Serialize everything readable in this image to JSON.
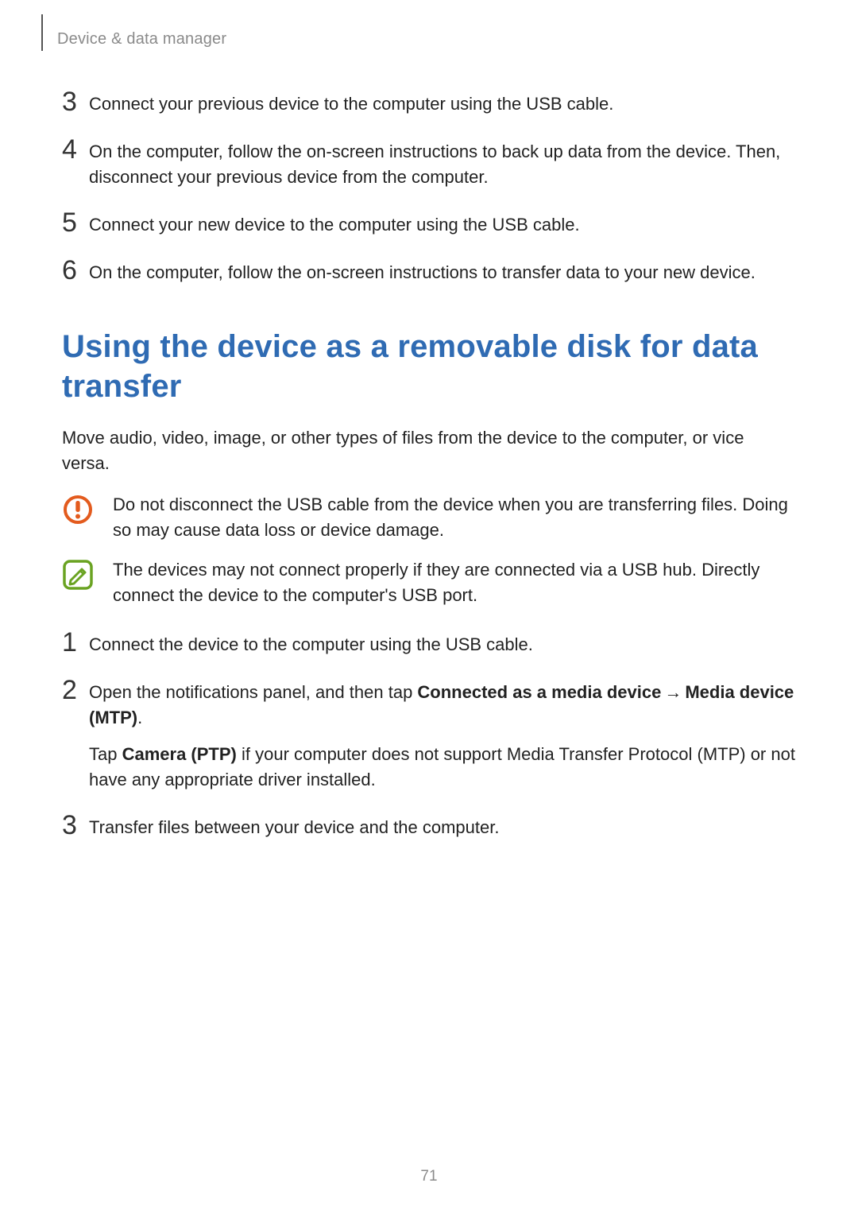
{
  "breadcrumb": "Device & data manager",
  "top_steps": [
    {
      "num": "3",
      "text": "Connect your previous device to the computer using the USB cable."
    },
    {
      "num": "4",
      "text": "On the computer, follow the on-screen instructions to back up data from the device. Then, disconnect your previous device from the computer."
    },
    {
      "num": "5",
      "text": "Connect your new device to the computer using the USB cable."
    },
    {
      "num": "6",
      "text": "On the computer, follow the on-screen instructions to transfer data to your new device."
    }
  ],
  "section_heading": "Using the device as a removable disk for data transfer",
  "intro_para": "Move audio, video, image, or other types of files from the device to the computer, or vice versa.",
  "warning_text": "Do not disconnect the USB cable from the device when you are transferring files. Doing so may cause data loss or device damage.",
  "note_text": "The devices may not connect properly if they are connected via a USB hub. Directly connect the device to the computer's USB port.",
  "bottom_steps": {
    "s1": {
      "num": "1",
      "text": "Connect the device to the computer using the USB cable."
    },
    "s2": {
      "num": "2",
      "lead": "Open the notifications panel, and then tap ",
      "bold1": "Connected as a media device",
      "arrow": "→",
      "bold2": "Media device (MTP)",
      "tail1": ".",
      "extra_lead": "Tap ",
      "extra_bold": "Camera (PTP)",
      "extra_tail": " if your computer does not support Media Transfer Protocol (MTP) or not have any appropriate driver installed."
    },
    "s3": {
      "num": "3",
      "text": "Transfer files between your device and the computer."
    }
  },
  "page_number": "71",
  "icons": {
    "warning": "alert-icon",
    "note": "pencil-square-icon"
  },
  "colors": {
    "heading": "#2f6bb3",
    "warning": "#e35b1e",
    "note": "#6aa322"
  }
}
